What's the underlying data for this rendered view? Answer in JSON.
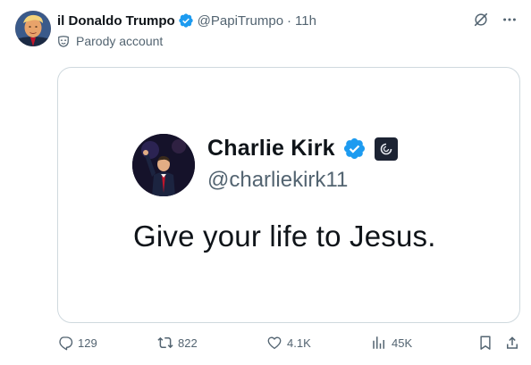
{
  "post": {
    "author": {
      "display_name": "il Donaldo Trumpo",
      "handle": "@PapiTrumpo",
      "verified": true,
      "label": "Parody account",
      "label_icon": "mask-icon"
    },
    "separator": "·",
    "time": "11h",
    "top_actions": [
      "grok-icon",
      "more-icon"
    ],
    "media": {
      "embedded_post": {
        "display_name": "Charlie Kirk",
        "handle": "@charliekirk11",
        "verified": true,
        "affiliate_badge": "affiliate-badge-icon",
        "text": "Give your life to Jesus."
      }
    },
    "stats": {
      "replies": "129",
      "reposts": "822",
      "likes": "4.1K",
      "views": "45K"
    }
  },
  "colors": {
    "text_primary": "#0f1419",
    "text_secondary": "#536471",
    "verified_blue": "#1d9bf0",
    "border": "#cfd9de"
  }
}
